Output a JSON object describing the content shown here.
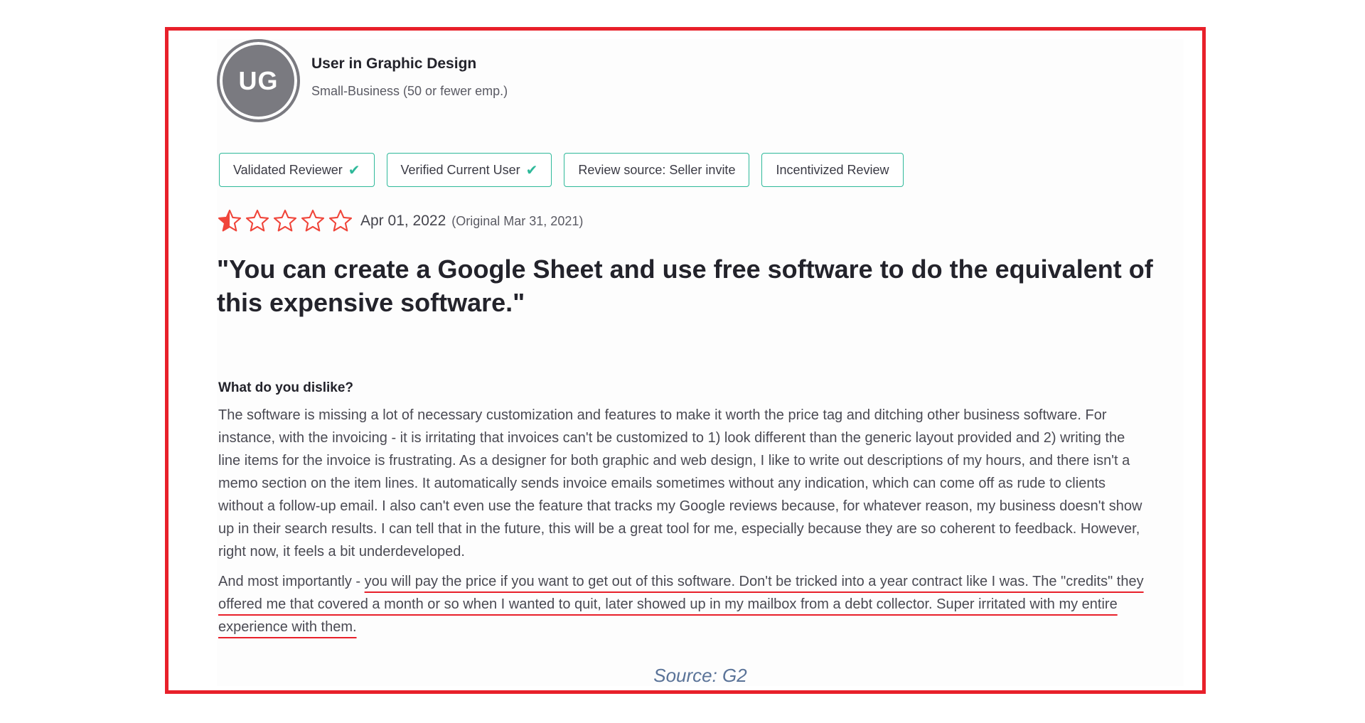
{
  "reviewer": {
    "initials": "UG",
    "name": "User in Graphic Design",
    "company_size": "Small-Business (50 or fewer emp.)"
  },
  "badges": [
    {
      "label": "Validated Reviewer",
      "checked": true
    },
    {
      "label": "Verified Current User",
      "checked": true
    },
    {
      "label": "Review source: Seller invite",
      "checked": false
    },
    {
      "label": "Incentivized Review",
      "checked": false
    }
  ],
  "rating": {
    "value": 0.5,
    "max": 5,
    "date": "Apr 01, 2022",
    "original": "(Original Mar 31, 2021)"
  },
  "review": {
    "title": "\"You can create a Google Sheet and use free software to do the equivalent of this expensive software.\"",
    "dislike_label": "What do you dislike?",
    "paragraph1": "The software is missing a lot of necessary customization and features to make it worth the price tag and ditching other business software. For instance, with the invoicing - it is irritating that invoices can't be customized to 1) look different than the generic layout provided and 2) writing the line items for the invoice is frustrating. As a designer for both graphic and web design, I like to write out descriptions of my hours, and there isn't a memo section on the item lines. It automatically sends invoice emails sometimes without any indication, which can come off as rude to clients without a follow-up email. I also can't even use the feature that tracks my Google reviews because, for whatever reason, my business doesn't show up in their search results. I can tell that in the future, this will be a great tool for me, especially because they are so coherent to feedback. However, right now, it feels a bit underdeveloped.",
    "paragraph2_lead": "And most importantly - ",
    "paragraph2_highlight": "you will pay the price if you want to get out of this software. Don't be tricked into a year contract like I was. The \"credits\" they offered me that covered a month or so when I wanted to quit, later showed up in my mailbox from a debt collector. Super irritated with my entire experience with them."
  },
  "source": "Source: G2",
  "colors": {
    "frame": "#e8202a",
    "star": "#f0453a",
    "badge_border": "#2fb99a",
    "avatar": "#7a7a80",
    "source_text": "#5a7398"
  }
}
